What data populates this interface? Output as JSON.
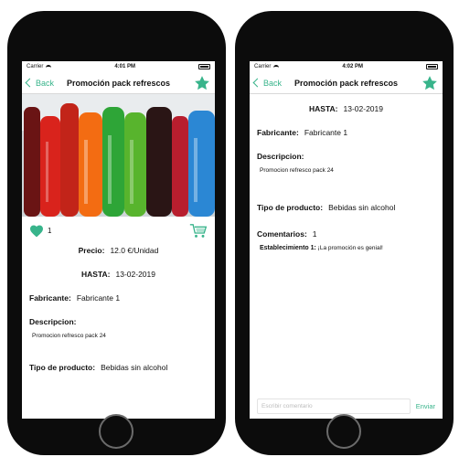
{
  "left": {
    "status": {
      "carrier": "Carrier",
      "time": "4:01 PM"
    },
    "nav": {
      "back_label": "Back",
      "title": "Promoción pack refrescos"
    },
    "likes_count": "1",
    "price": {
      "label": "Precio:",
      "value": "12.0 €/Unidad"
    },
    "until": {
      "label": "HASTA:",
      "value": "13-02-2019"
    },
    "manufacturer": {
      "label": "Fabricante:",
      "value": "Fabricante 1"
    },
    "description": {
      "label": "Descripcion:",
      "value": "Promocion refresco pack 24"
    },
    "product_type": {
      "label": "Tipo de producto:",
      "value": "Bebidas sin alcohol"
    }
  },
  "right": {
    "status": {
      "carrier": "Carrier",
      "time": "4:02 PM"
    },
    "nav": {
      "back_label": "Back",
      "title": "Promoción pack refrescos"
    },
    "until": {
      "label": "HASTA:",
      "value": "13-02-2019"
    },
    "manufacturer": {
      "label": "Fabricante:",
      "value": "Fabricante 1"
    },
    "description": {
      "label": "Descripcion:",
      "value": "Promocion refresco pack 24"
    },
    "product_type": {
      "label": "Tipo de producto:",
      "value": "Bebidas sin alcohol"
    },
    "comments": {
      "label": "Comentarios:",
      "value": "1"
    },
    "comment_item": {
      "author": "Establecimiento 1:",
      "text": "¡La promoción es genial!"
    },
    "comment_input": {
      "placeholder": "Escribir comentario"
    },
    "send_label": "Enviar"
  },
  "icons": {
    "star": "star-icon",
    "heart": "heart-icon",
    "cart": "cart-icon",
    "back": "chevron-left-icon"
  },
  "colors": {
    "accent": "#38b48b"
  }
}
